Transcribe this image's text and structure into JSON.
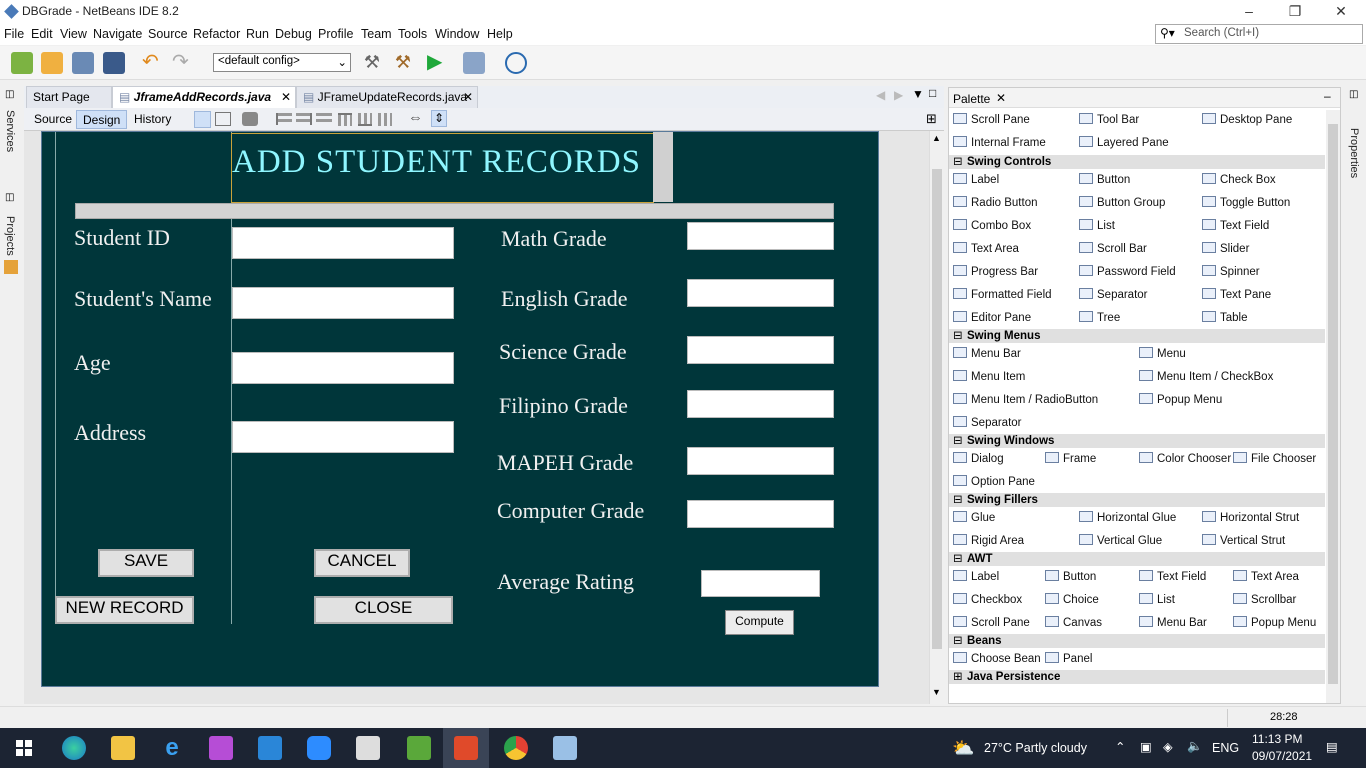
{
  "window": {
    "title": "DBGrade - NetBeans IDE 8.2"
  },
  "menu": [
    "File",
    "Edit",
    "View",
    "Navigate",
    "Source",
    "Refactor",
    "Run",
    "Debug",
    "Profile",
    "Team",
    "Tools",
    "Window",
    "Help"
  ],
  "search": {
    "placeholder": "Search (Ctrl+I)"
  },
  "toolbar": {
    "config": "<default config>"
  },
  "tabs": [
    "Start Page",
    "JframeAddRecords.java",
    "JFrameUpdateRecords.java"
  ],
  "design": {
    "source": "Source",
    "design": "Design",
    "history": "History"
  },
  "form": {
    "title": "ADD STUDENT RECORDS",
    "left_labels": [
      "Student ID",
      "Student's Name",
      "Age",
      "Address"
    ],
    "right_labels": [
      "Math Grade",
      "English Grade",
      "Science Grade",
      "Filipino Grade",
      "MAPEH Grade",
      "Computer Grade"
    ],
    "average": "Average Rating",
    "buttons": {
      "save": "SAVE",
      "cancel": "CANCEL",
      "new": "NEW RECORD",
      "close": "CLOSE",
      "compute": "Compute"
    }
  },
  "side": {
    "services": "Services",
    "projects": "Projects",
    "properties": "Properties"
  },
  "palette": {
    "title": "Palette",
    "top": [
      "Scroll Pane",
      "Tool Bar",
      "Desktop Pane",
      "Internal Frame",
      "Layered Pane"
    ],
    "groups": [
      {
        "name": "Swing Controls",
        "items": [
          "Label",
          "Button",
          "Check Box",
          "Radio Button",
          "Button Group",
          "Toggle Button",
          "Combo Box",
          "List",
          "Text Field",
          "Text Area",
          "Scroll Bar",
          "Slider",
          "Progress Bar",
          "Password Field",
          "Spinner",
          "Formatted Field",
          "Separator",
          "Text Pane",
          "Editor Pane",
          "Tree",
          "Table"
        ]
      },
      {
        "name": "Swing Menus",
        "items": [
          "Menu Bar",
          "Menu",
          "Menu Item",
          "Menu Item / CheckBox",
          "Menu Item / RadioButton",
          "Popup Menu",
          "Separator"
        ]
      },
      {
        "name": "Swing Windows",
        "items": [
          "Dialog",
          "Frame",
          "Color Chooser",
          "File Chooser",
          "Option Pane"
        ]
      },
      {
        "name": "Swing Fillers",
        "items": [
          "Glue",
          "Horizontal Glue",
          "Horizontal Strut",
          "Rigid Area",
          "Vertical Glue",
          "Vertical Strut"
        ]
      },
      {
        "name": "AWT",
        "items": [
          "Label",
          "Button",
          "Text Field",
          "Text Area",
          "Checkbox",
          "Choice",
          "List",
          "Scrollbar",
          "Scroll Pane",
          "Canvas",
          "Menu Bar",
          "Popup Menu"
        ]
      },
      {
        "name": "Beans",
        "items": [
          "Choose Bean",
          "Panel"
        ]
      },
      {
        "name": "Java Persistence",
        "items": []
      }
    ]
  },
  "status": {
    "position": "28:28"
  },
  "taskbar": {
    "weather": "27°C  Partly cloudy",
    "lang": "ENG",
    "time": "11:13 PM",
    "date": "09/07/2021"
  }
}
